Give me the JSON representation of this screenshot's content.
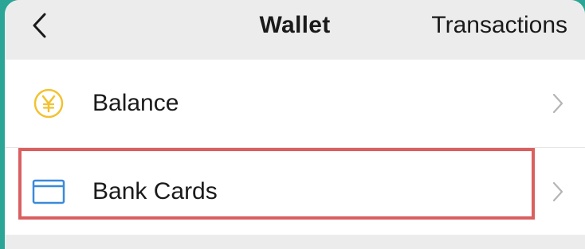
{
  "header": {
    "title": "Wallet",
    "right_link": "Transactions"
  },
  "list": [
    {
      "label": "Balance",
      "icon": "yen-coin-icon"
    },
    {
      "label": "Bank Cards",
      "icon": "bank-card-icon"
    }
  ],
  "colors": {
    "accent_yellow": "#f2c230",
    "card_blue": "#3b8ad9",
    "highlight_red": "#d9605f",
    "chevron_grey": "#b5b5b5"
  },
  "highlight": {
    "target": "Bank Cards"
  }
}
